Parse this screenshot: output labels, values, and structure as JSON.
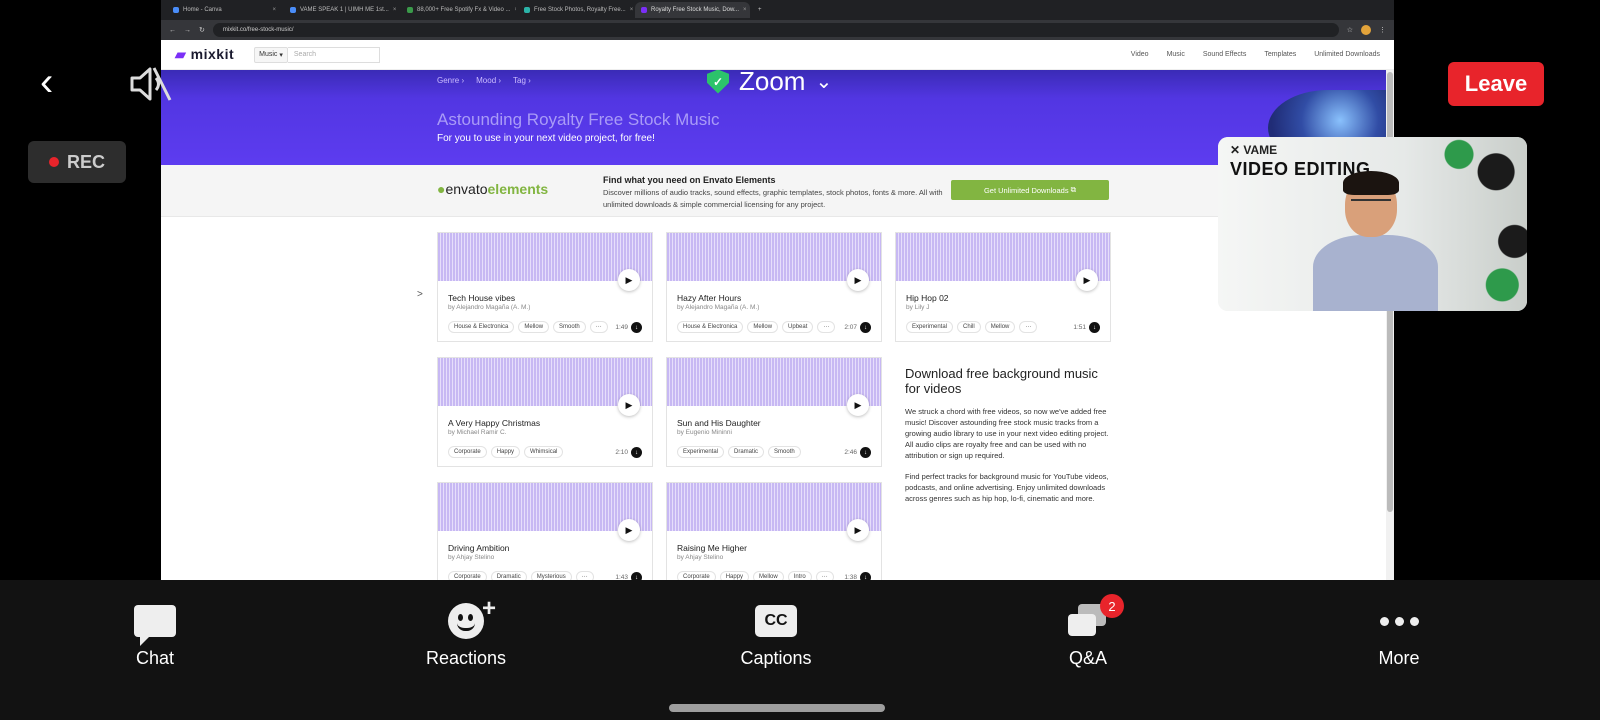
{
  "browser": {
    "tabs": [
      {
        "title": "Home - Canva",
        "active": false
      },
      {
        "title": "VAME SPEAK 1 | UIMH ME 1st...",
        "active": false
      },
      {
        "title": "88,000+ Free Spotify Fx & Video ...",
        "active": false
      },
      {
        "title": "Free Stock Photos, Royalty Free...",
        "active": false
      },
      {
        "title": "Royalty Free Stock Music, Dow...",
        "active": true
      }
    ],
    "url": "mixkit.co/free-stock-music/"
  },
  "site": {
    "logo": "mixkit",
    "category_select": "Music",
    "search_placeholder": "Search",
    "nav_links": [
      "Video",
      "Music",
      "Sound Effects",
      "Templates",
      "Unlimited Downloads"
    ],
    "breadcrumbs": [
      "Genre",
      "Mood",
      "Tag"
    ],
    "hero_title": "Astounding Royalty Free Stock Music",
    "hero_subtitle": "For you to use in your next video project, for free!",
    "envato": {
      "logo_word1": "envato",
      "logo_word2": "elements",
      "heading": "Find what you need on Envato Elements",
      "description": "Discover millions of audio tracks, sound effects, graphic templates, stock photos, fonts & more. All with unlimited downloads & simple commercial licensing for any project.",
      "button": "Get Unlimited Downloads"
    },
    "tracks": [
      {
        "title": "Tech House vibes",
        "author": "by Alejandro Magaña (A. M.)",
        "tags": [
          "House & Electronica",
          "Mellow",
          "Smooth",
          "···"
        ],
        "duration": "1:49"
      },
      {
        "title": "Hazy After Hours",
        "author": "by Alejandro Magaña (A. M.)",
        "tags": [
          "House & Electronica",
          "Mellow",
          "Upbeat",
          "···"
        ],
        "duration": "2:07"
      },
      {
        "title": "Hip Hop 02",
        "author": "by Lily J",
        "tags": [
          "Experimental",
          "Chill",
          "Mellow",
          "···"
        ],
        "duration": "1:51"
      },
      {
        "title": "A Very Happy Christmas",
        "author": "by Michael Ramir C.",
        "tags": [
          "Corporate",
          "Happy",
          "Whimsical"
        ],
        "duration": "2:10"
      },
      {
        "title": "Sun and His Daughter",
        "author": "by Eugenio Mininni",
        "tags": [
          "Experimental",
          "Dramatic",
          "Smooth"
        ],
        "duration": "2:46"
      },
      {
        "title": "Driving Ambition",
        "author": "by Ahjay Stelino",
        "tags": [
          "Corporate",
          "Dramatic",
          "Mysterious",
          "···"
        ],
        "duration": "1:43"
      },
      {
        "title": "Raising Me Higher",
        "author": "by Ahjay Stelino",
        "tags": [
          "Corporate",
          "Happy",
          "Mellow",
          "Intro",
          "···"
        ],
        "duration": "1:38"
      }
    ],
    "side_heading": "Download free background music for videos",
    "side_p1": "We struck a chord with free videos, so now we've added free music! Discover astounding free stock music tracks from a growing audio library to use in your next video editing project. All audio clips are royalty free and can be used with no attribution or sign up required.",
    "side_p2": "Find perfect tracks for background music for YouTube videos, podcasts, and online advertising. Enjoy unlimited downloads across genres such as hip hop, lo-fi, cinematic and more."
  },
  "zoom": {
    "title": "Zoom",
    "leave": "Leave",
    "rec": "REC",
    "video_brand": "VAME",
    "video_title": "VIDEO EDITING",
    "toolbar": [
      {
        "label": "Chat",
        "icon": "chat-icon"
      },
      {
        "label": "Reactions",
        "icon": "reactions-icon"
      },
      {
        "label": "Captions",
        "icon": "captions-icon",
        "icon_text": "CC"
      },
      {
        "label": "Q&A",
        "icon": "qa-icon",
        "badge": "2"
      },
      {
        "label": "More",
        "icon": "more-icon"
      }
    ],
    "colors": {
      "leave": "#e8242b",
      "secure": "#2cc36b",
      "accent": "#5d3cf0"
    }
  }
}
